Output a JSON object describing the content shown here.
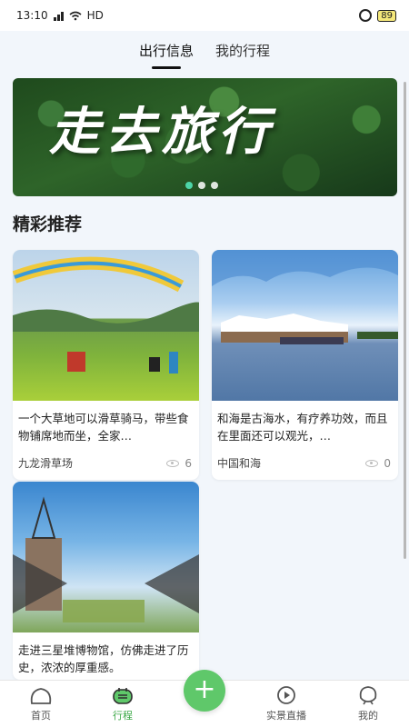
{
  "status": {
    "time": "13:10",
    "network": "HD",
    "battery": "89"
  },
  "tabs": [
    {
      "label": "出行信息",
      "active": true
    },
    {
      "label": "我的行程",
      "active": false
    }
  ],
  "banner": {
    "title": "走去旅行"
  },
  "section": {
    "title": "精彩推荐"
  },
  "cards": [
    {
      "text": "一个大草地可以滑草骑马，带些食物铺席地而坐，全家…",
      "location": "九龙滑草场",
      "views": "6"
    },
    {
      "text": "和海是古海水，有疗养功效，而且在里面还可以观光，…",
      "location": "中国和海",
      "views": "0"
    },
    {
      "text": "走进三星堆博物馆，仿佛走进了历史，浓浓的厚重感。",
      "location": "",
      "views": ""
    }
  ],
  "nav": [
    {
      "label": "首页",
      "icon": "home-icon"
    },
    {
      "label": "行程",
      "icon": "itinerary-icon",
      "active": true
    },
    {
      "label": "",
      "icon": "add-icon",
      "symbol": "+"
    },
    {
      "label": "实景直播",
      "icon": "live-icon"
    },
    {
      "label": "我的",
      "icon": "profile-icon"
    }
  ],
  "colors": {
    "accent": "#5fc86a",
    "nav_active": "#3aa845",
    "background": "#f2f6fb"
  }
}
